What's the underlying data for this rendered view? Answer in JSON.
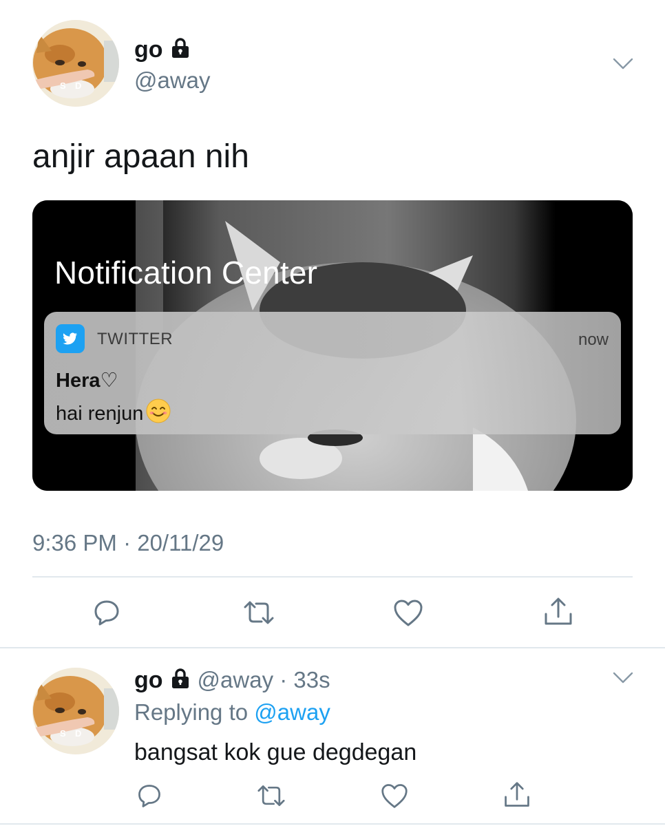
{
  "tweet": {
    "author_name": "go",
    "author_handle": "@away",
    "avatar_letters": [
      "S",
      "D"
    ],
    "text": "anjir apaan nih",
    "timestamp": "9:36 PM · 20/11/29"
  },
  "media": {
    "notification_center_title": "Notification Center",
    "notification": {
      "app_name": "TWITTER",
      "time": "now",
      "sender": "Hera♡",
      "message": "hai renjun"
    }
  },
  "reply": {
    "author_name": "go",
    "handle_time": "@away · 33s",
    "avatar_letters": [
      "S",
      "D"
    ],
    "replying_prefix": "Replying to",
    "replying_mention": "@away",
    "text": "bangsat kok gue degdegan"
  },
  "colors": {
    "accent": "#1da1f2",
    "secondary_text": "#657786",
    "primary_text": "#14171a",
    "divider": "#e1e8ed"
  },
  "icons": {
    "actions": [
      "reply-icon",
      "retweet-icon",
      "like-icon",
      "share-icon"
    ],
    "menu": "chevron-down-icon",
    "protected": "lock-icon"
  }
}
